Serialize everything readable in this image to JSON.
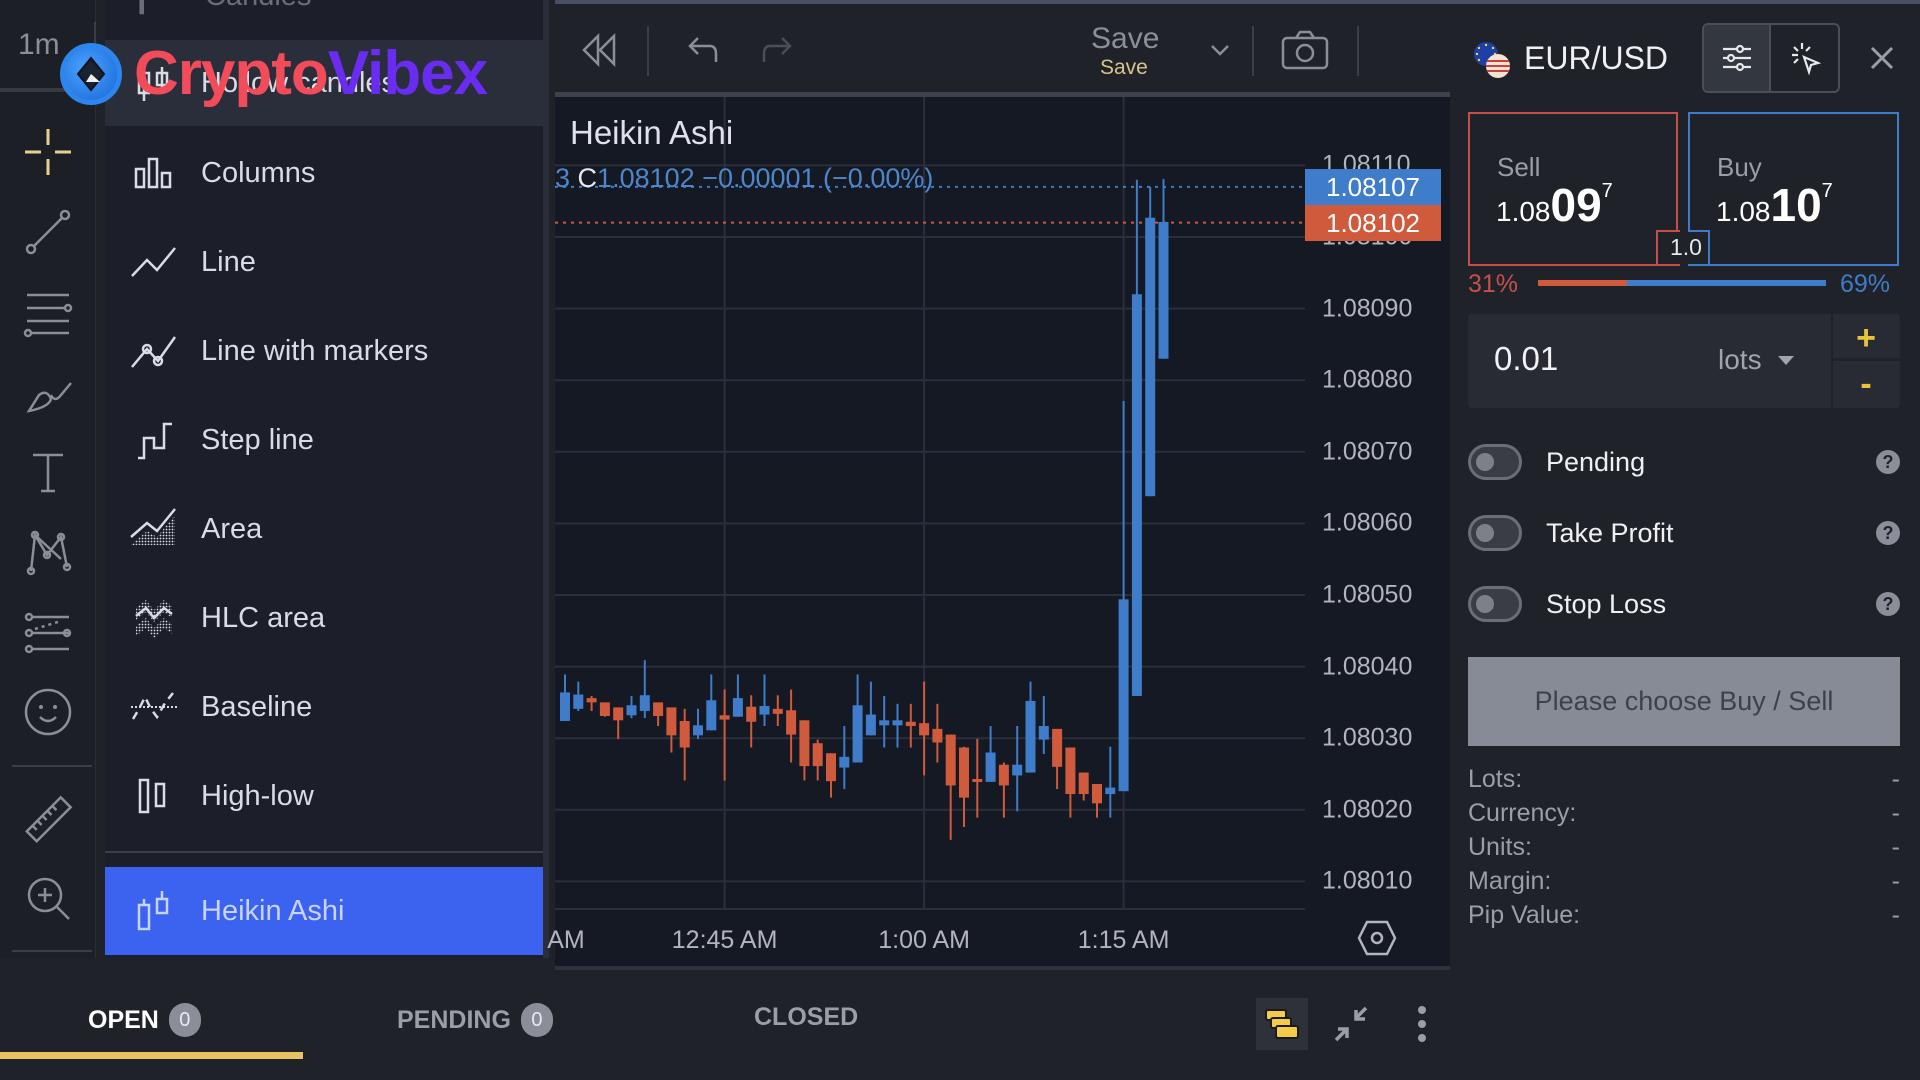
{
  "toolbar_left": {
    "interval": "1m",
    "tools": [
      {
        "name": "crosshair-icon",
        "active": true
      },
      {
        "name": "trend-line-icon"
      },
      {
        "name": "fib-levels-icon"
      },
      {
        "name": "brush-icon"
      },
      {
        "name": "text-icon"
      },
      {
        "name": "pattern-icon"
      },
      {
        "name": "prediction-icon"
      },
      {
        "name": "emoji-icon"
      },
      {
        "name": "ruler-icon"
      },
      {
        "name": "zoom-in-icon"
      }
    ]
  },
  "watermark": {
    "part_a": "Crypto",
    "part_b": "Vibex",
    "color_a": "#f24b59",
    "color_b": "#6a2cf0"
  },
  "chart_type_menu": {
    "partial_top_item": "Candles",
    "items": [
      {
        "label": "Hollow candles",
        "icon": "hollow-candles-icon",
        "state": "hover"
      },
      {
        "label": "Columns",
        "icon": "columns-icon"
      },
      {
        "label": "Line",
        "icon": "line-icon"
      },
      {
        "label": "Line with markers",
        "icon": "line-with-markers-icon"
      },
      {
        "label": "Step line",
        "icon": "step-line-icon"
      },
      {
        "label": "Area",
        "icon": "area-icon"
      },
      {
        "label": "HLC area",
        "icon": "hlc-area-icon"
      },
      {
        "label": "Baseline",
        "icon": "baseline-icon"
      },
      {
        "label": "High-low",
        "icon": "high-low-icon"
      },
      {
        "label": "Heikin Ashi",
        "icon": "heikin-ashi-icon",
        "state": "selected"
      }
    ],
    "selected_color": "#3b63f0"
  },
  "top_toolbar": {
    "save_label": "Save",
    "save_sublabel": "Save"
  },
  "chart": {
    "title": "Heikin Ashi",
    "legend_prefix": "3",
    "legend_close_letter": "C",
    "legend_close": "1.08102",
    "legend_change": "−0.00001 (−0.00%)",
    "buy_price_tag": "1.08107",
    "sell_price_tag": "1.08102",
    "bull_color": "#3f7cc9",
    "bear_color": "#d05a3c"
  },
  "chart_data": {
    "type": "candlestick",
    "style": "Heikin Ashi",
    "interval": "1m",
    "ylim": [
      1.08,
      1.08118
    ],
    "y_ticks": [
      "1.08110",
      "1.08100",
      "1.08090",
      "1.08080",
      "1.08070",
      "1.08060",
      "1.08050",
      "1.08040",
      "1.08030",
      "1.08020",
      "1.08010"
    ],
    "y_tick_values": [
      1.0811,
      1.081,
      1.0809,
      1.0808,
      1.0807,
      1.0806,
      1.0805,
      1.0804,
      1.0803,
      1.0802,
      1.0801
    ],
    "x_ticks": [
      {
        "label": "AM",
        "minute_index": 2
      },
      {
        "label": "12:45 AM",
        "minute_index": 12
      },
      {
        "label": "1:00 AM",
        "minute_index": 27
      },
      {
        "label": "1:15 AM",
        "minute_index": 42
      }
    ],
    "first_candle_time": "12:33 AM",
    "last_close": 1.08102,
    "bid_line": 1.08102,
    "ask_line": 1.08107,
    "candles": [
      {
        "o": 1.080324,
        "h": 1.080389,
        "l": 1.080324,
        "c": 1.080364
      },
      {
        "o": 1.080341,
        "h": 1.080379,
        "l": 1.080338,
        "c": 1.080361
      },
      {
        "o": 1.080356,
        "h": 1.080359,
        "l": 1.080338,
        "c": 1.08035
      },
      {
        "o": 1.08035,
        "h": 1.08035,
        "l": 1.08033,
        "c": 1.080331
      },
      {
        "o": 1.080343,
        "h": 1.080343,
        "l": 1.080299,
        "c": 1.080325
      },
      {
        "o": 1.080332,
        "h": 1.080359,
        "l": 1.080328,
        "c": 1.080346
      },
      {
        "o": 1.080338,
        "h": 1.080409,
        "l": 1.080328,
        "c": 1.08036
      },
      {
        "o": 1.08035,
        "h": 1.08035,
        "l": 1.080317,
        "c": 1.080331
      },
      {
        "o": 1.080343,
        "h": 1.080343,
        "l": 1.08028,
        "c": 1.080304
      },
      {
        "o": 1.080324,
        "h": 1.080341,
        "l": 1.080241,
        "c": 1.080287
      },
      {
        "o": 1.080304,
        "h": 1.080341,
        "l": 1.080299,
        "c": 1.080318
      },
      {
        "o": 1.080311,
        "h": 1.080389,
        "l": 1.080311,
        "c": 1.080353
      },
      {
        "o": 1.080332,
        "h": 1.080368,
        "l": 1.080241,
        "c": 1.080326
      },
      {
        "o": 1.08033,
        "h": 1.080389,
        "l": 1.08033,
        "c": 1.080356
      },
      {
        "o": 1.080344,
        "h": 1.08036,
        "l": 1.080287,
        "c": 1.080323
      },
      {
        "o": 1.080333,
        "h": 1.080389,
        "l": 1.080317,
        "c": 1.080345
      },
      {
        "o": 1.080341,
        "h": 1.08036,
        "l": 1.080317,
        "c": 1.080334
      },
      {
        "o": 1.080339,
        "h": 1.080368,
        "l": 1.080266,
        "c": 1.080305
      },
      {
        "o": 1.080325,
        "h": 1.080325,
        "l": 1.080241,
        "c": 1.080261
      },
      {
        "o": 1.080293,
        "h": 1.080298,
        "l": 1.080241,
        "c": 1.080261
      },
      {
        "o": 1.080279,
        "h": 1.080279,
        "l": 1.080217,
        "c": 1.08024
      },
      {
        "o": 1.080259,
        "h": 1.080317,
        "l": 1.080229,
        "c": 1.080274
      },
      {
        "o": 1.080266,
        "h": 1.080389,
        "l": 1.080266,
        "c": 1.080346
      },
      {
        "o": 1.080304,
        "h": 1.080379,
        "l": 1.080304,
        "c": 1.080333
      },
      {
        "o": 1.080318,
        "h": 1.080359,
        "l": 1.080287,
        "c": 1.080325
      },
      {
        "o": 1.080318,
        "h": 1.080348,
        "l": 1.080287,
        "c": 1.080325
      },
      {
        "o": 1.080323,
        "h": 1.080348,
        "l": 1.080287,
        "c": 1.080317
      },
      {
        "o": 1.080321,
        "h": 1.080379,
        "l": 1.080248,
        "c": 1.080304
      },
      {
        "o": 1.080313,
        "h": 1.080348,
        "l": 1.080266,
        "c": 1.080294
      },
      {
        "o": 1.080305,
        "h": 1.080305,
        "l": 1.080158,
        "c": 1.080234
      },
      {
        "o": 1.080287,
        "h": 1.080288,
        "l": 1.080176,
        "c": 1.080217
      },
      {
        "o": 1.080243,
        "h": 1.080299,
        "l": 1.080189,
        "c": 1.080239
      },
      {
        "o": 1.080239,
        "h": 1.080317,
        "l": 1.080239,
        "c": 1.08028
      },
      {
        "o": 1.080263,
        "h": 1.080266,
        "l": 1.080189,
        "c": 1.080234
      },
      {
        "o": 1.080248,
        "h": 1.080317,
        "l": 1.080198,
        "c": 1.080263
      },
      {
        "o": 1.080252,
        "h": 1.080379,
        "l": 1.080252,
        "c": 1.080352
      },
      {
        "o": 1.080298,
        "h": 1.080359,
        "l": 1.080278,
        "c": 1.080317
      },
      {
        "o": 1.080313,
        "h": 1.080313,
        "l": 1.080229,
        "c": 1.08026
      },
      {
        "o": 1.080287,
        "h": 1.080287,
        "l": 1.080189,
        "c": 1.080222
      },
      {
        "o": 1.080252,
        "h": 1.080252,
        "l": 1.080213,
        "c": 1.080222
      },
      {
        "o": 1.080236,
        "h": 1.080236,
        "l": 1.080189,
        "c": 1.080209
      },
      {
        "o": 1.080222,
        "h": 1.080288,
        "l": 1.080189,
        "c": 1.080231
      },
      {
        "o": 1.080226,
        "h": 1.080771,
        "l": 1.080226,
        "c": 1.080494
      },
      {
        "o": 1.080359,
        "h": 1.08108,
        "l": 1.080359,
        "c": 1.08092
      },
      {
        "o": 1.080638,
        "h": 1.08107,
        "l": 1.080638,
        "c": 1.081027
      },
      {
        "o": 1.08083,
        "h": 1.081081,
        "l": 1.08083,
        "c": 1.081021
      }
    ]
  },
  "trade_panel": {
    "symbol": "EUR/USD",
    "sell_label": "Sell",
    "sell_price_prefix": "1.08",
    "sell_price_big": "09",
    "sell_price_sup": "7",
    "buy_label": "Buy",
    "buy_price_prefix": "1.08",
    "buy_price_big": "10",
    "buy_price_sup": "7",
    "spread": "1.0",
    "sentiment_sell_pct": "31%",
    "sentiment_buy_pct": "69%",
    "sentiment_sell_fraction": 0.31,
    "lot_size": "0.01",
    "lot_unit": "lots",
    "plus_label": "+",
    "minus_label": "-",
    "toggles": [
      {
        "label": "Pending",
        "on": false
      },
      {
        "label": "Take Profit",
        "on": false
      },
      {
        "label": "Stop Loss",
        "on": false
      }
    ],
    "help_glyph": "?",
    "action_button": "Please choose Buy / Sell",
    "info": [
      {
        "label": "Lots:",
        "value": "-"
      },
      {
        "label": "Currency:",
        "value": "-"
      },
      {
        "label": "Units:",
        "value": "-"
      },
      {
        "label": "Margin:",
        "value": "-"
      },
      {
        "label": "Pip Value:",
        "value": "-"
      }
    ]
  },
  "bottom_tabs": [
    {
      "label": "OPEN",
      "count": "0",
      "active": true
    },
    {
      "label": "PENDING",
      "count": "0"
    },
    {
      "label": "CLOSED"
    }
  ]
}
